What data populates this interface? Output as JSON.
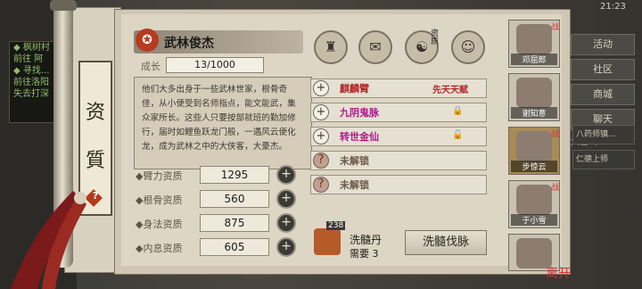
{
  "status_bar": {
    "time": "21:23"
  },
  "left_panel": {
    "lines": [
      "◆ 枫树村",
      "  前往 阿",
      "◆ 寻找...",
      "  前往洛阳",
      "  失去打深"
    ]
  },
  "right_menu": {
    "buttons": [
      "活动",
      "社区",
      "商城",
      "聊天"
    ],
    "location": "大雪山"
  },
  "right_quests": [
    "八药师镇...",
    "仁德上师"
  ],
  "scroll": {
    "tab_chars": [
      "资",
      "質"
    ],
    "help_glyph": "?"
  },
  "hero": {
    "symbol_glyph": "✪",
    "name": "武林俊杰",
    "growth_label": "成长",
    "growth_value": "13/1000"
  },
  "description": "他们大多出身于一些武林世家，根骨奇佳，从小便受到名师指点，能文能武，集众家所长。这些人只要按部就班的勤加修行，届时如鲤鱼跃龙门般，一遇风云便化龙，成为武林之中的大侠客，大豪杰。",
  "attributes": [
    {
      "label": "◆臂力资质",
      "value": "1295"
    },
    {
      "label": "◆根骨资质",
      "value": "560"
    },
    {
      "label": "◆身法资质",
      "value": "875"
    },
    {
      "label": "◆内息资质",
      "value": "605"
    }
  ],
  "plus_glyph": "+",
  "top_icons": [
    {
      "name": "hat-icon",
      "glyph": "♜"
    },
    {
      "name": "scroll-icon",
      "glyph": "✉"
    },
    {
      "name": "taiji-icon",
      "glyph": "☯"
    },
    {
      "name": "figure-icon",
      "glyph": "☺"
    }
  ],
  "icon_badge": "资质",
  "skills": [
    {
      "add": "+",
      "title": "麒麟臂",
      "extra": "先天天赋",
      "lock": "",
      "color": "#b02828"
    },
    {
      "add": "+",
      "title": "九阴鬼脉",
      "extra": "",
      "lock": "🔒",
      "color": "#b01890"
    },
    {
      "add": "+",
      "title": "转世金仙",
      "extra": "",
      "lock": "🔓",
      "color": "#b01890"
    },
    {
      "add": "?",
      "title": "未解锁",
      "extra": "",
      "lock": "",
      "color": "#6a5a4a"
    },
    {
      "add": "?",
      "title": "未解锁",
      "extra": "",
      "lock": "",
      "color": "#6a5a4a"
    }
  ],
  "dan": {
    "count": "238",
    "name": "洗髓丹",
    "need_label": "需要",
    "need_value": "3"
  },
  "cleanse_button": "洗髓伐脉",
  "heroes": [
    {
      "name": "邓屈郎",
      "mark": "战",
      "selected": false
    },
    {
      "name": "谢知意",
      "mark": "",
      "selected": false
    },
    {
      "name": "步惊云",
      "mark": "战",
      "selected": true
    },
    {
      "name": "于小雪",
      "mark": "战",
      "selected": false
    },
    {
      "name": "",
      "mark": "",
      "selected": false
    }
  ],
  "bottom_icon": "离开"
}
